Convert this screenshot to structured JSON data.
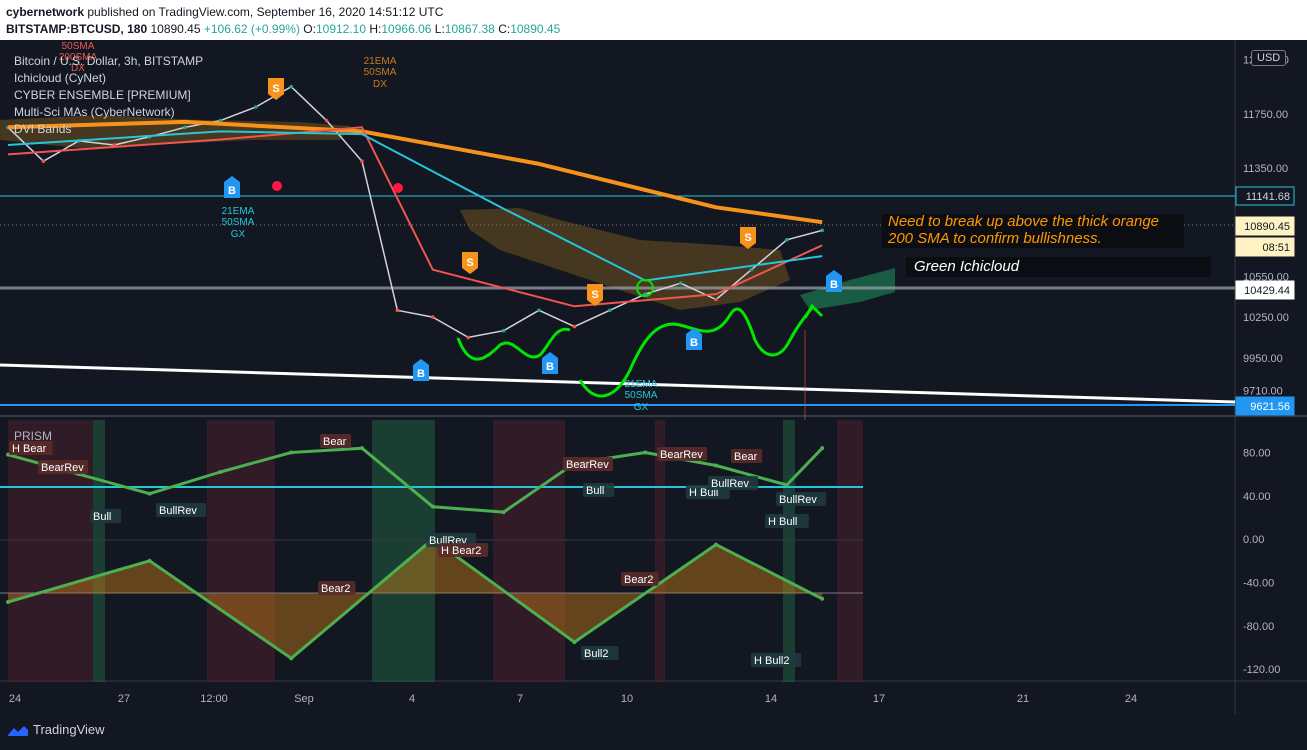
{
  "header": {
    "author": "cybernetwork",
    "published_text": "published on TradingView.com, September 16, 2020 14:51:12 UTC",
    "symbol": "BITSTAMP:BTCUSD, 180",
    "last": "10890.45",
    "change": "+106.62 (+0.99%)",
    "o_label": "O:",
    "o": "10912.10",
    "h_label": "H:",
    "h": "10966.06",
    "l_label": "L:",
    "l": "10867.38",
    "c_label": "C:",
    "c": "10890.45"
  },
  "legend": {
    "title": "Bitcoin / U.S. Dollar, 3h, BITSTAMP",
    "indicators": [
      "Ichicloud (CyNet)",
      "CYBER ENSEMBLE [PREMIUM]",
      "Multi-Sci MAs (CyberNetwork)",
      "DVI Bands"
    ]
  },
  "currency_button": "USD",
  "annotations": {
    "note_line1": "Need to break up above the thick orange",
    "note_line2": "200 SMA to confirm bullishness.",
    "green_cloud": "Green Ichicloud",
    "ema_cross_top": [
      "21EMA",
      "50SMA",
      "DX"
    ],
    "ema_cross_left": [
      "21EMA",
      "50SMA",
      "GX"
    ],
    "ema_cross_bottom": [
      "21EMA",
      "50SMA",
      "GX"
    ],
    "sma_top_left": [
      "50SMA",
      "200SMA",
      "DX"
    ]
  },
  "oscillator": {
    "name": "PRISM",
    "labels": [
      "H Bear",
      "BearRev",
      "Bull",
      "BullRev",
      "Bear",
      "BullRev",
      "H Bear2",
      "Bear2",
      "BearRev",
      "Bull",
      "BearRev",
      "Bear",
      "H Bull",
      "BullRev",
      "BullRev",
      "H Bull",
      "Bear2",
      "Bull2",
      "H Bull2"
    ]
  },
  "colors": {
    "background": "#131722",
    "sma200": "#f7931a",
    "ema21": "#f0564f",
    "sma50": "#26c6da",
    "white_line": "#ffffff",
    "blue_line": "#2196f3",
    "buy_marker": "#2196f3",
    "sell_marker": "#f7931a",
    "green_arrow": "#00e600",
    "osc_green": "#4caf50",
    "osc_orange": "#c77d17",
    "osc_yellow": "#ffeb3b",
    "osc_pink": "#f48fb1",
    "osc_purple": "#ba68c8",
    "osc_teal": "#26c6da"
  },
  "branding": "TradingView",
  "chart_data": [
    {
      "type": "line",
      "title": "Bitcoin / U.S. Dollar, 3h, BITSTAMP",
      "x_tick_labels": [
        "24",
        "27",
        "12:00",
        "Sep",
        "4",
        "7",
        "10",
        "14",
        "17",
        "21",
        "24"
      ],
      "y_tick_labels": [
        "12150.00",
        "11750.00",
        "11350.00",
        "10950.00",
        "10550.00",
        "10250.00",
        "9950.00",
        "9710.00"
      ],
      "price_labels": [
        "11141.68",
        "10890.45",
        "08:51",
        "10429.44",
        "9621.56"
      ],
      "ylim": [
        9550,
        12250
      ],
      "series": [
        {
          "name": "Price",
          "x": [
            24,
            25,
            26,
            27,
            28,
            29,
            30,
            31,
            32,
            33,
            34,
            35,
            36,
            37,
            38,
            39,
            40,
            41,
            42,
            43,
            44,
            45,
            46,
            47
          ],
          "values": [
            11650,
            11400,
            11550,
            11520,
            11580,
            11650,
            11700,
            11800,
            11950,
            11700,
            11400,
            10300,
            10250,
            10100,
            10150,
            10300,
            10180,
            10300,
            10420,
            10500,
            10380,
            10600,
            10820,
            10890
          ]
        },
        {
          "x": [
            24,
            29,
            34,
            39,
            44,
            47
          ],
          "values": [
            11650,
            11690,
            11620,
            11380,
            11060,
            10950
          ]
        },
        {
          "x": [
            24,
            30,
            34,
            36,
            40,
            44,
            47
          ],
          "values": [
            11450,
            11560,
            11650,
            10600,
            10330,
            10420,
            10780
          ]
        },
        {
          "x": [
            24,
            30,
            34,
            38,
            42,
            47
          ],
          "values": [
            11520,
            11620,
            11600,
            11050,
            10520,
            10700
          ]
        }
      ]
    },
    {
      "type": "line",
      "title": "PRISM",
      "y_tick_labels": [
        "80.00",
        "40.00",
        "0.00",
        "-40.00",
        "-80.00",
        "-120.00"
      ],
      "ylim": [
        -130,
        110
      ],
      "series": [
        {
          "x": [
            24,
            26,
            28,
            30,
            32,
            34,
            36,
            38,
            40,
            42,
            44,
            46,
            47
          ],
          "values": [
            78,
            60,
            42,
            62,
            80,
            84,
            30,
            25,
            70,
            80,
            68,
            50,
            84
          ]
        },
        {
          "x": [
            24,
            28,
            32,
            36,
            40,
            44,
            47
          ],
          "values": [
            -58,
            -20,
            -110,
            0,
            -95,
            -5,
            -55
          ]
        }
      ]
    }
  ]
}
